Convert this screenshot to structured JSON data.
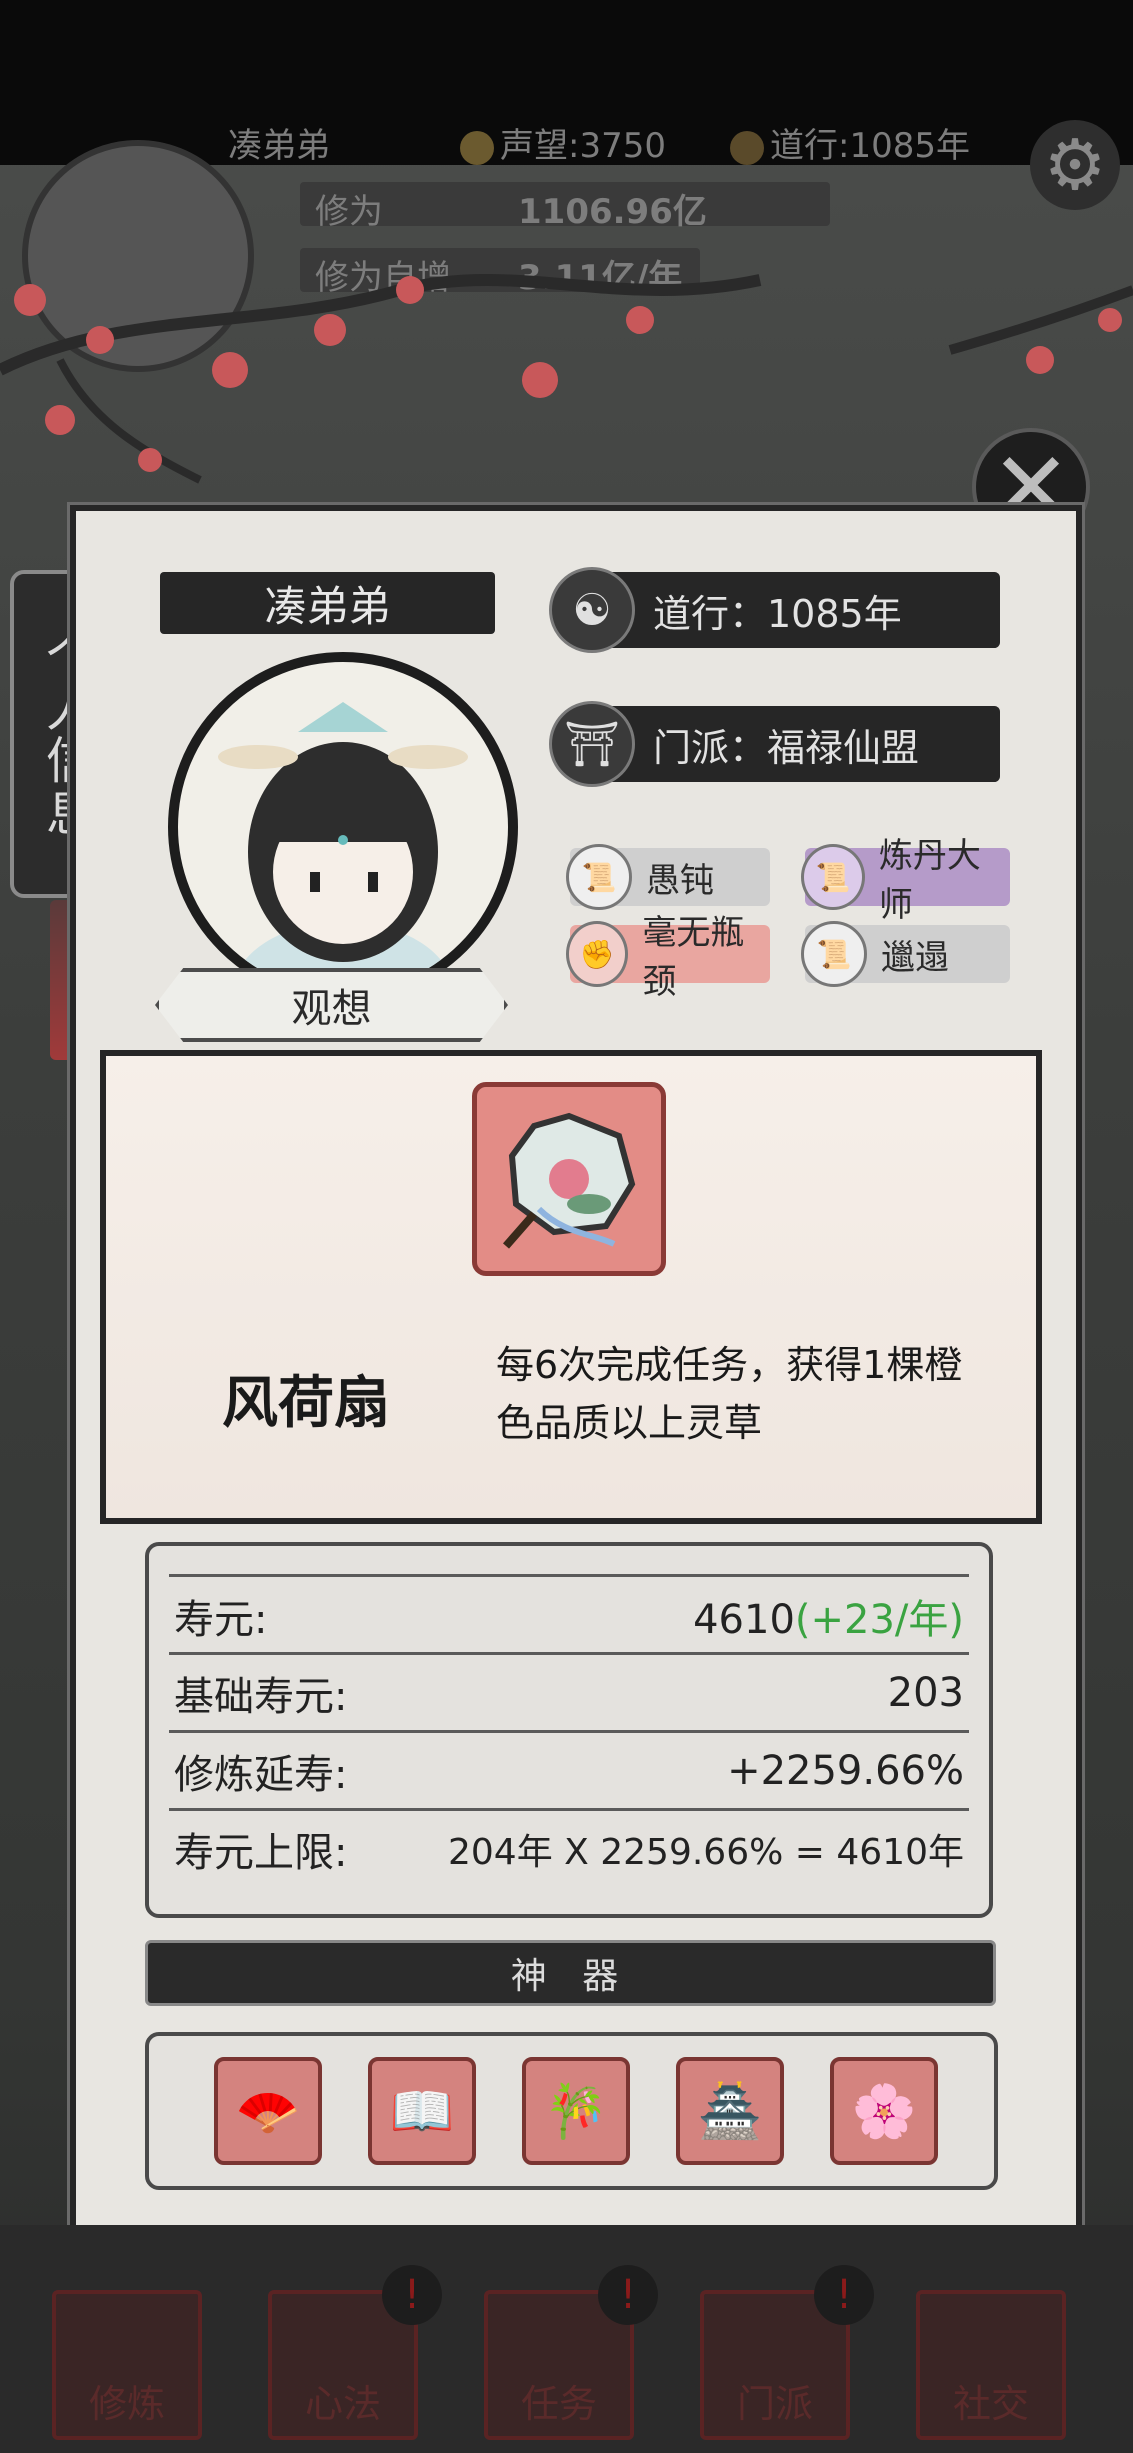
{
  "hud": {
    "player_name": "凑弟弟",
    "reputation": "声望:3750",
    "daoxing": "道行:1085年",
    "cultivation_label": "修为",
    "cultivation_value": "1106.96亿",
    "auto_label": "修为自增",
    "auto_value": "3.11亿/年"
  },
  "side_tab": {
    "label": "个人信息"
  },
  "profile": {
    "name": "凑弟弟",
    "daoxing": "道行：1085年",
    "sect": "门派：福禄仙盟",
    "visualize": "观想",
    "traits": [
      {
        "label": "愚钝",
        "icon": "scroll-icon"
      },
      {
        "label": "炼丹大师",
        "icon": "scroll-icon"
      },
      {
        "label": "毫无瓶颈",
        "icon": "fist-icon"
      },
      {
        "label": "邋遢",
        "icon": "scroll-icon"
      }
    ]
  },
  "item": {
    "name": "风荷扇",
    "desc_line1": "每6次完成任务，获得1棵橙",
    "desc_line2": "色品质以上灵草"
  },
  "stats": {
    "rows": [
      {
        "label": "寿元:",
        "value": "4610",
        "extra": "(+23/年)"
      },
      {
        "label": "基础寿元:",
        "value": "203",
        "extra": ""
      },
      {
        "label": "修炼延寿:",
        "value": "+2259.66%",
        "extra": ""
      },
      {
        "label": "寿元上限:",
        "value": "204年 X 2259.66% = 4610年",
        "extra": ""
      }
    ]
  },
  "artifacts": {
    "title": "神 器",
    "items": [
      "fan-icon",
      "book-icon",
      "flute-icon",
      "seal-icon",
      "round-fan-icon"
    ]
  },
  "nav": {
    "items": [
      "修炼",
      "心法",
      "任务",
      "门派",
      "社交"
    ]
  },
  "colors": {
    "accent_green": "#3aa341",
    "item_red": "#e38c86",
    "nav_red": "#5a2323"
  }
}
